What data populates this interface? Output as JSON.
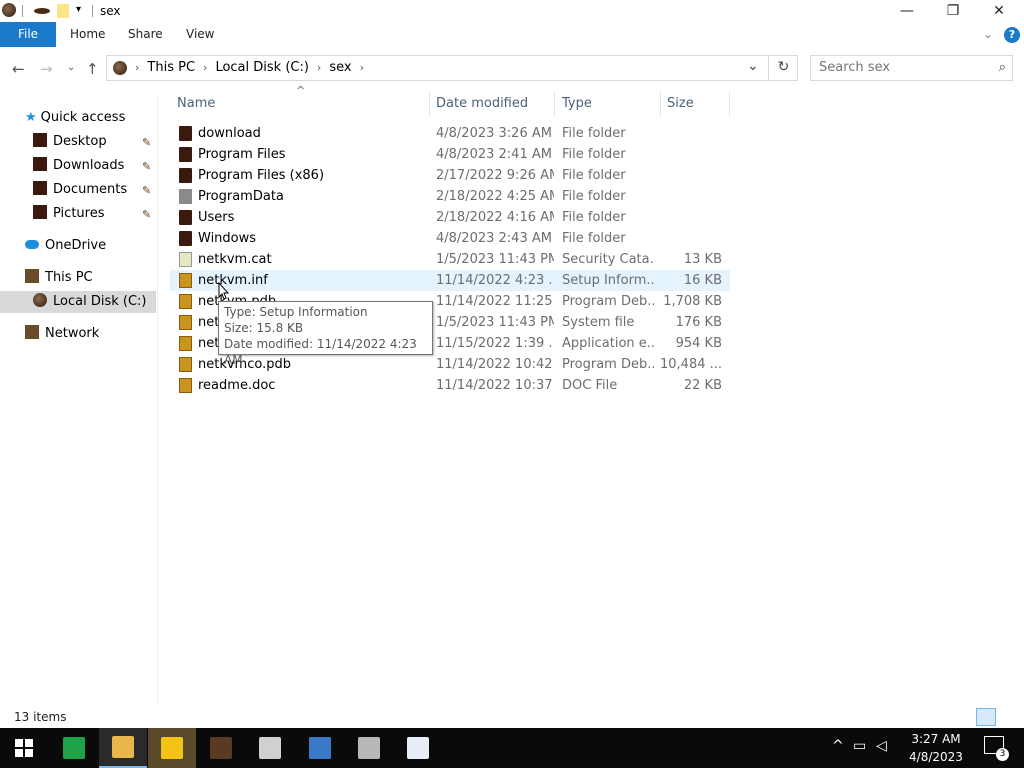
{
  "window": {
    "title": "sex",
    "minimize_glyph": "—",
    "maximize_glyph": "❐",
    "close_glyph": "✕"
  },
  "ribbon": {
    "tabs": [
      {
        "label": "File"
      },
      {
        "label": "Home"
      },
      {
        "label": "Share"
      },
      {
        "label": "View"
      }
    ],
    "expand_glyph": "⌄",
    "help_glyph": "?"
  },
  "address": {
    "crumbs": [
      "This PC",
      "Local Disk (C:)",
      "sex"
    ],
    "refresh_glyph": "↻",
    "dropdown_glyph": "⌄"
  },
  "search": {
    "placeholder": "Search sex"
  },
  "nav": {
    "quick_access": "Quick access",
    "quick_items": [
      "Desktop",
      "Downloads",
      "Documents",
      "Pictures"
    ],
    "onedrive": "OneDrive",
    "this_pc": "This PC",
    "local_disk": "Local Disk (C:)",
    "network": "Network"
  },
  "columns": {
    "name": "Name",
    "date": "Date modified",
    "type": "Type",
    "size": "Size"
  },
  "files": [
    {
      "name": "download",
      "date": "4/8/2023 3:26 AM",
      "type": "File folder",
      "size": "",
      "icon": "folder"
    },
    {
      "name": "Program Files",
      "date": "4/8/2023 2:41 AM",
      "type": "File folder",
      "size": "",
      "icon": "folder"
    },
    {
      "name": "Program Files (x86)",
      "date": "2/17/2022 9:26 AM",
      "type": "File folder",
      "size": "",
      "icon": "folder"
    },
    {
      "name": "ProgramData",
      "date": "2/18/2022 4:25 AM",
      "type": "File folder",
      "size": "",
      "icon": "folder-light"
    },
    {
      "name": "Users",
      "date": "2/18/2022 4:16 AM",
      "type": "File folder",
      "size": "",
      "icon": "folder"
    },
    {
      "name": "Windows",
      "date": "4/8/2023 2:43 AM",
      "type": "File folder",
      "size": "",
      "icon": "folder"
    },
    {
      "name": "netkvm.cat",
      "date": "1/5/2023 11:43 PM",
      "type": "Security Cata...",
      "size": "13 KB",
      "icon": "cat"
    },
    {
      "name": "netkvm.inf",
      "date": "11/14/2022 4:23 ...",
      "type": "Setup Inform...",
      "size": "16 KB",
      "icon": "file"
    },
    {
      "name": "netkvm.pdb",
      "date": "11/14/2022 11:25...",
      "type": "Program Deb...",
      "size": "1,708 KB",
      "icon": "file"
    },
    {
      "name": "netkvm.sys",
      "date": "1/5/2023 11:43 PM",
      "type": "System file",
      "size": "176 KB",
      "icon": "file"
    },
    {
      "name": "netkvmco.dll",
      "date": "11/15/2022 1:39 ...",
      "type": "Application e...",
      "size": "954 KB",
      "icon": "file"
    },
    {
      "name": "netkvmco.pdb",
      "date": "11/14/2022 10:42...",
      "type": "Program Deb...",
      "size": "10,484 ...",
      "icon": "file"
    },
    {
      "name": "readme.doc",
      "date": "11/14/2022 10:37...",
      "type": "DOC File",
      "size": "22 KB",
      "icon": "file"
    }
  ],
  "tooltip": {
    "type_line": "Type: Setup Information",
    "size_line": "Size: 15.8 KB",
    "date_line": "Date modified: 11/14/2022 4:23 AM"
  },
  "status": {
    "item_count": "13 items"
  },
  "taskbar": {
    "time": "3:27 AM",
    "date": "4/8/2023",
    "notification_count": "3"
  },
  "colors": {
    "accent": "#1979ca",
    "hover_row": "#e5f3ff",
    "selected_nav": "#d9d9d9",
    "taskbar": "#0a0a0a"
  }
}
